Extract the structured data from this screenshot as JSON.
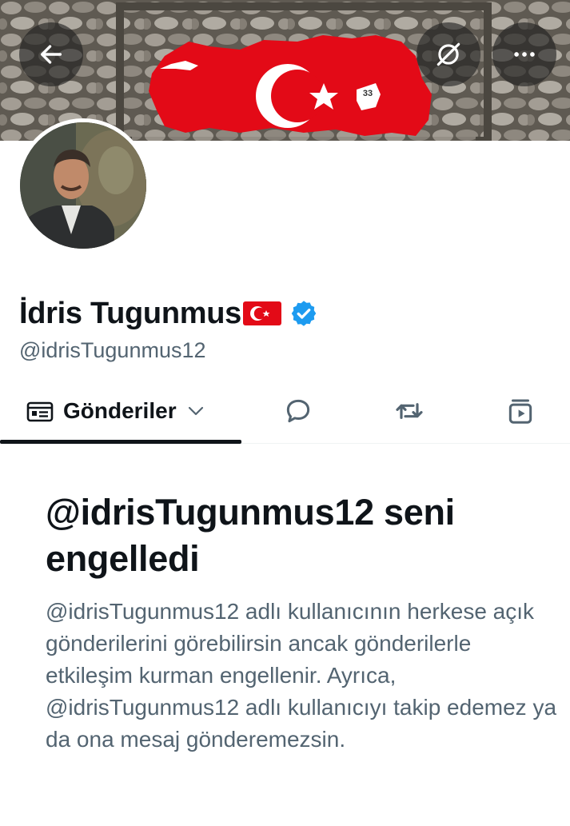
{
  "profile": {
    "display_name": "İdris Tugunmus",
    "handle": "@idrisTugunmus12",
    "verified": true,
    "name_emoji": "turkish-flag",
    "banner_badge": "33"
  },
  "header": {
    "back_icon": "arrow-left-icon",
    "unfollow_icon": "crossed-circle-icon",
    "more_icon": "ellipsis-icon"
  },
  "tabs": {
    "posts_label": "Gönderiler",
    "items": [
      "posts",
      "replies",
      "reposts",
      "media"
    ]
  },
  "blocked": {
    "title": "@idrisTugunmus12 seni engelledi",
    "body": "@idrisTugunmus12 adlı kullanıcının herkese açık gönderilerini görebilirsin ancak gönderilerle etkileşim kurman engellenir. Ayrıca, @idrisTugunmus12 adlı kullanıcıyı takip edemez ya da ona mesaj gönderemezsin."
  },
  "colors": {
    "text_primary": "#0f1419",
    "text_secondary": "#536471",
    "verified_blue": "#1d9bf0",
    "flag_red": "#e30a17"
  }
}
